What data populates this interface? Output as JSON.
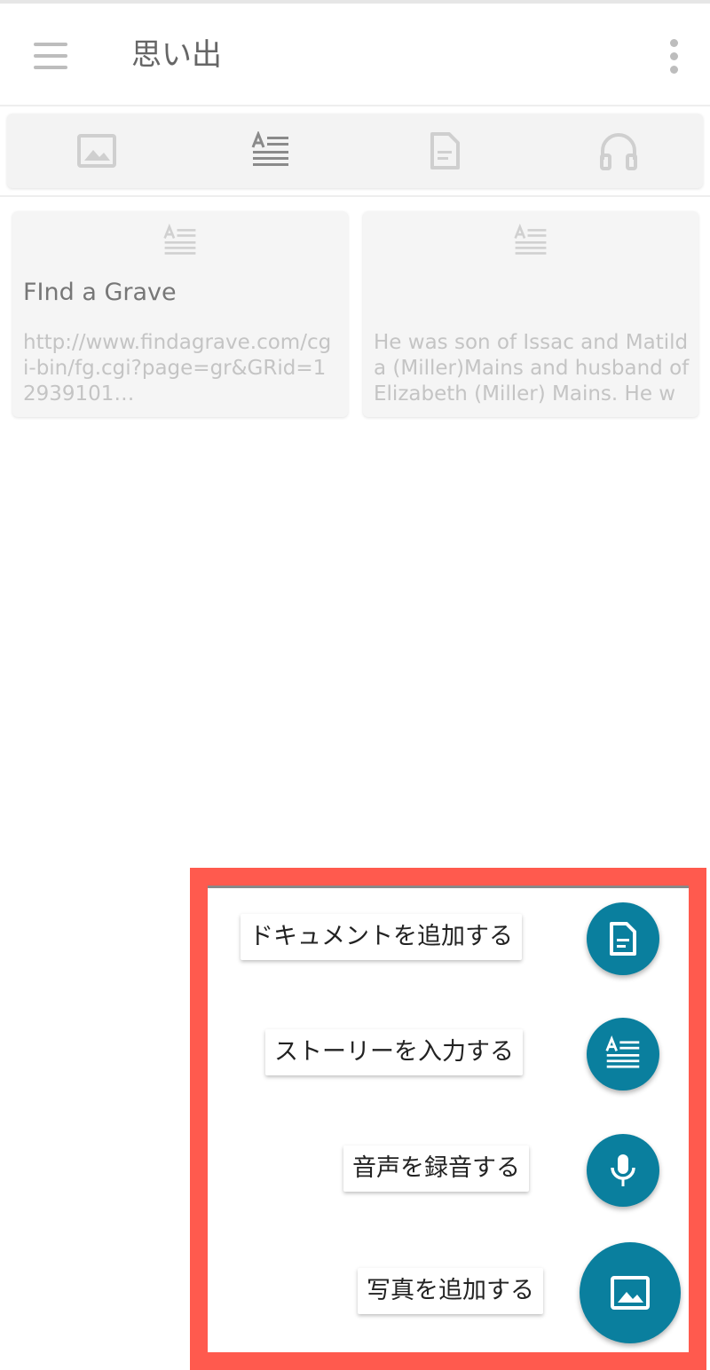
{
  "app_bar": {
    "title": "思い出",
    "menu_icon": "hamburger-menu-icon",
    "more_icon": "more-vert-icon"
  },
  "filter_tabs": [
    {
      "name": "photos",
      "icon": "image-icon"
    },
    {
      "name": "stories",
      "icon": "story-text-icon"
    },
    {
      "name": "documents",
      "icon": "document-icon"
    },
    {
      "name": "audio",
      "icon": "headphones-icon"
    }
  ],
  "cards": [
    {
      "icon": "story-text-icon",
      "title": "FInd a Grave",
      "body": "http://www.findagrave.com/cgi-bin/fg.cgi?page=gr&GRid=12939101…"
    },
    {
      "icon": "story-text-icon",
      "title": "",
      "body": "He was son of Issac and Matilda (Miller)Mains and husband of Elizabeth (Miller) Mains. He wa…"
    }
  ],
  "fab_menu": {
    "add_document": {
      "label": "ドキュメントを追加する",
      "icon": "document-icon"
    },
    "enter_story": {
      "label": "ストーリーを入力する",
      "icon": "story-text-icon"
    },
    "record_audio": {
      "label": "音声を録音する",
      "icon": "microphone-icon"
    },
    "add_photo": {
      "label": "写真を追加する",
      "icon": "image-icon"
    }
  },
  "colors": {
    "fab": "#0a7f9e",
    "highlight_border": "#ff5a4e",
    "muted_icon": "#c8c8c8"
  }
}
